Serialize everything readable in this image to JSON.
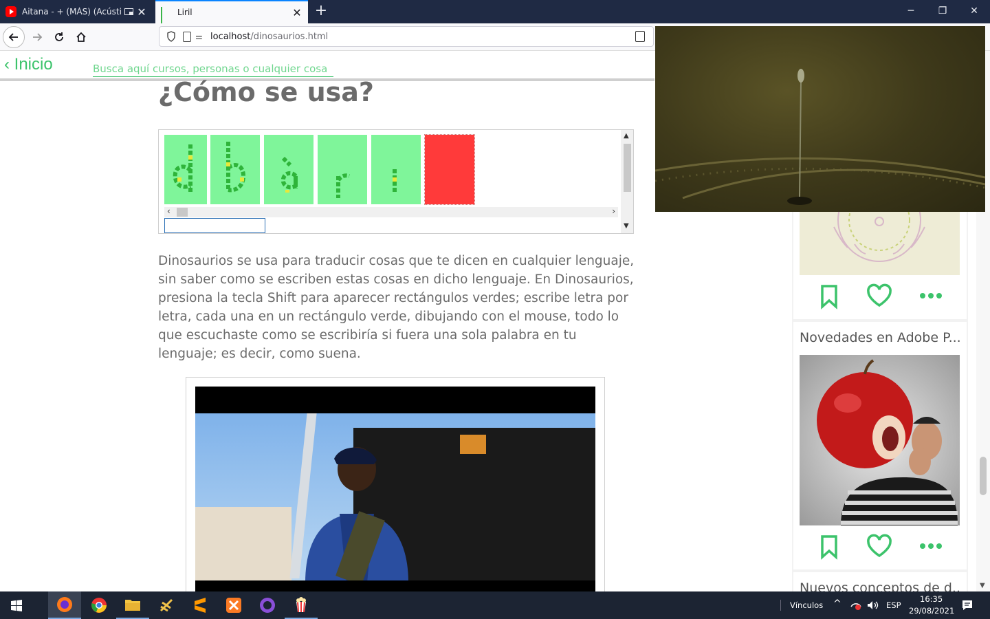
{
  "browser": {
    "tabs": [
      {
        "title": "Aitana - + (MÁS) (Acústico)",
        "favicon": "youtube-icon",
        "active": false
      },
      {
        "title": "Liril",
        "favicon": "liril-icon",
        "active": true
      }
    ],
    "new_tab_label": "+",
    "window_controls": {
      "minimize": "─",
      "restore": "❐",
      "close": "✕"
    },
    "url": {
      "host": "localhost",
      "path": "/dinosaurios.html"
    }
  },
  "site": {
    "back_label": "‹ Inicio",
    "search_placeholder": "Busca aquí cursos, personas o cualquier cosa"
  },
  "main": {
    "heading": "¿Cómo se usa?",
    "demo_letters": [
      "d",
      "b",
      "à",
      "r",
      "l"
    ],
    "paragraph": "Dinosaurios se usa para traducir cosas que te dicen en cualquier lenguaje, sin saber como se escriben estas cosas en dicho lenguaje. En Dinosaurios, presiona la tecla Shift para aparecer rectángulos verdes; escribe letra por letra, cada una en un rectángulo verde, dibujando con el mouse, todo lo que escuchaste como se escribiría si fuera una sola palabra en tu lenguaje; es decir, como suena."
  },
  "sidebar": {
    "cards": [
      {
        "title": "",
        "actions": [
          "bookmark-icon",
          "heart-icon",
          "more-icon"
        ]
      },
      {
        "title": "Novedades en Adobe P...",
        "actions": [
          "bookmark-icon",
          "heart-icon",
          "more-icon"
        ]
      },
      {
        "title": "Nuevos conceptos de d..."
      }
    ]
  },
  "taskbar": {
    "apps": [
      "firefox-icon",
      "chrome-icon",
      "file-explorer-icon",
      "scratch-icon",
      "sublime-text-icon",
      "xampp-icon",
      "github-desktop-icon",
      "popcorn-icon"
    ],
    "links_label": "Vínculos",
    "language": "ESP",
    "time": "16:35",
    "date": "29/08/2021"
  },
  "colors": {
    "accent_green": "#3cc36b",
    "tile_green": "#7ff59a",
    "tile_red": "#ff3a3a",
    "text_gray": "#6b6b6b",
    "tab_strip": "#1f2a44"
  }
}
